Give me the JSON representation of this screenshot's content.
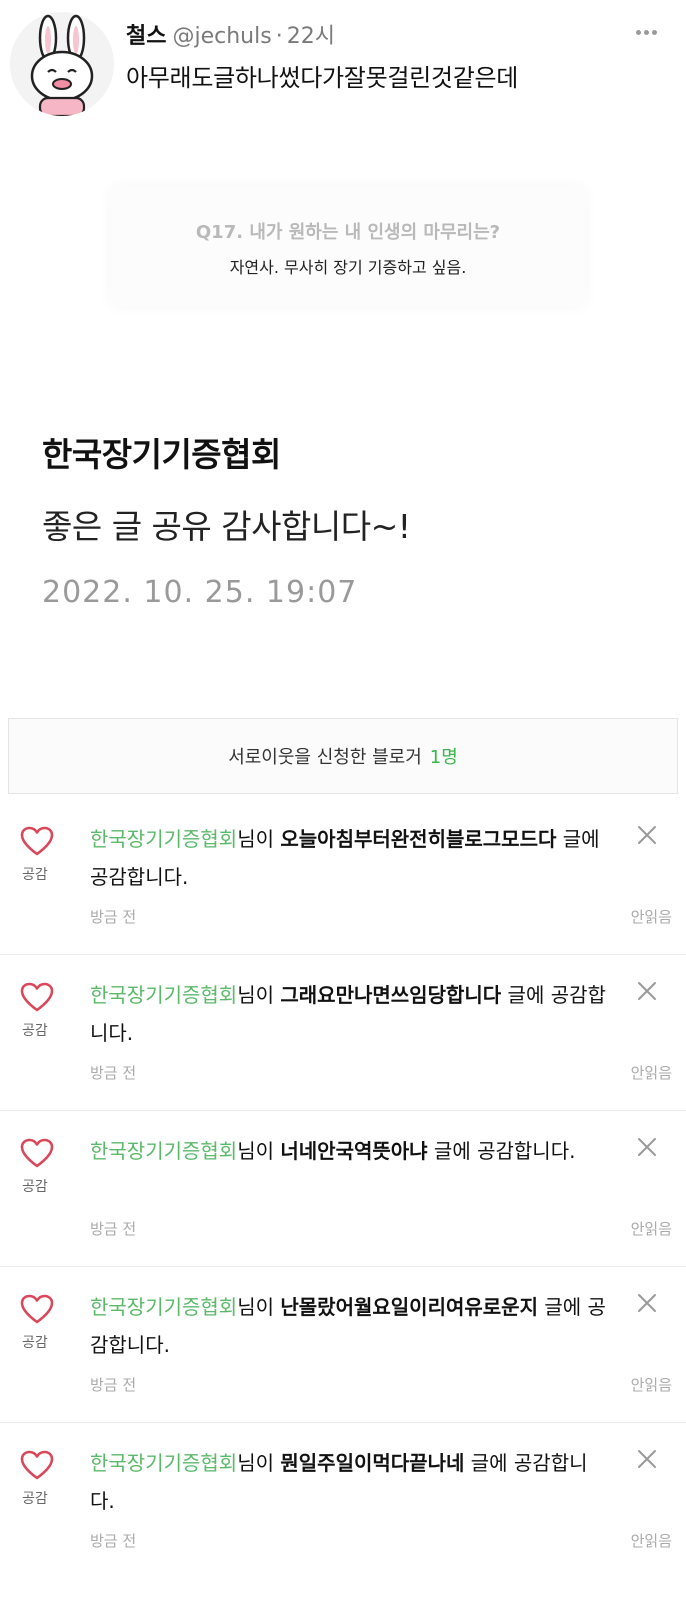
{
  "tweet": {
    "name": "철스",
    "handle": "@jechuls",
    "separator": "·",
    "time": "22시",
    "text": "아무래도글하나썼다가잘못걸린것같은데",
    "more_icon": "more-horizontal-icon"
  },
  "question_card": {
    "question": "Q17. 내가 원하는 내 인생의 마무리는?",
    "answer": "자연사. 무사히 장기 기증하고 싶음."
  },
  "comment": {
    "author": "한국장기기증협회",
    "body": "좋은 글 공유 감사합니다~!",
    "date": "2022. 10. 25. 19:07"
  },
  "neighbor": {
    "label": "서로이웃을 신청한 블로거",
    "count": "1명",
    "count_color": "#3cb54a"
  },
  "notifications": [
    {
      "user": "한국장기기증협회",
      "pre": "님이 ",
      "title": "오늘아침부터완전히블로그모드다",
      "post": " 글에 공감합니다.",
      "heart_label": "공감",
      "time": "방금 전",
      "status": "안읽음"
    },
    {
      "user": "한국장기기증협회",
      "pre": "님이 ",
      "title": "그래요만나면쓰임당합니다",
      "post": " 글에 공감합니다.",
      "heart_label": "공감",
      "time": "방금 전",
      "status": "안읽음"
    },
    {
      "user": "한국장기기증협회",
      "pre": "님이 ",
      "title": "너네안국역뜻아냐",
      "post": " 글에 공감합니다.",
      "heart_label": "공감",
      "time": "방금 전",
      "status": "안읽음"
    },
    {
      "user": "한국장기기증협회",
      "pre": "님이 ",
      "title": "난몰랐어월요일이리여유로운지",
      "post": " 글에 공감합니다.",
      "heart_label": "공감",
      "time": "방금 전",
      "status": "안읽음"
    },
    {
      "user": "한국장기기증협회",
      "pre": "님이 ",
      "title": "뭔일주일이먹다끝나네",
      "post": " 글에 공감합니다.",
      "heart_label": "공감",
      "time": "방금 전",
      "status": "안읽음"
    }
  ],
  "colors": {
    "user_green": "#5bb96a",
    "heart_red": "#d9475b"
  }
}
